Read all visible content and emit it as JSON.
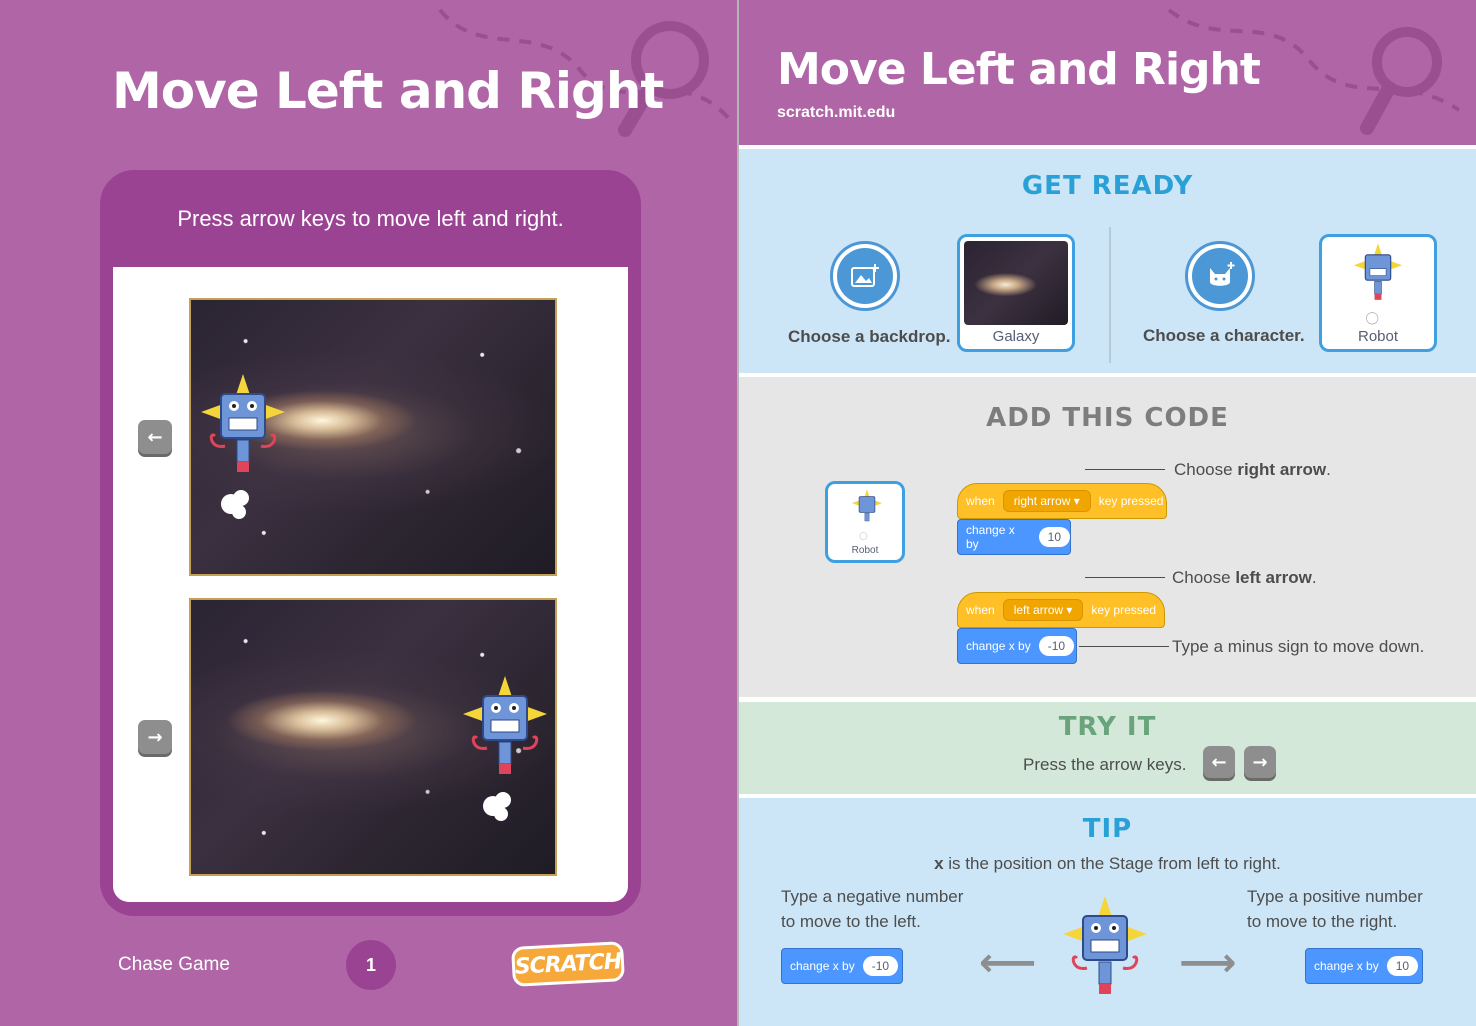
{
  "left": {
    "title": "Move Left and Right",
    "caption": "Press arrow keys to move left and right.",
    "key_left": "←",
    "key_right": "→",
    "footer_text": "Chase Game",
    "page_number": "1",
    "logo_text": "SCRATCH"
  },
  "right": {
    "title": "Move Left and Right",
    "url": "scratch.mit.edu",
    "get_ready": {
      "title": "GET READY",
      "backdrop_label": "Choose a backdrop.",
      "backdrop_thumb": "Galaxy",
      "character_label": "Choose a character.",
      "character_thumb": "Robot"
    },
    "add_code": {
      "title": "ADD THIS CODE",
      "sprite_label": "Robot",
      "script1": {
        "when": "when",
        "key": "right arrow",
        "pressed": "key pressed",
        "change": "change x by",
        "value": "10"
      },
      "script2": {
        "when": "when",
        "key": "left arrow",
        "pressed": "key pressed",
        "change": "change x by",
        "value": "-10"
      },
      "callout1_pre": "Choose ",
      "callout1_bold": "right arrow",
      "callout1_post": ".",
      "callout2_pre": "Choose ",
      "callout2_bold": "left arrow",
      "callout2_post": ".",
      "callout3": "Type a minus sign to move down."
    },
    "try_it": {
      "title": "TRY IT",
      "text": "Press the arrow keys.",
      "key_left": "←",
      "key_right": "→"
    },
    "tip": {
      "title": "TIP",
      "subtitle_bold": "x",
      "subtitle_rest": " is the position on the Stage from left to right.",
      "left_line1": "Type a negative number",
      "left_line2": "to move to the left.",
      "right_line1": "Type a positive number",
      "right_line2": "to move to the right.",
      "left_block": "change x by",
      "left_value": "-10",
      "right_block": "change x by",
      "right_value": "10"
    }
  },
  "colors": {
    "purple": "#b065a7",
    "dark_purple": "#9b4393",
    "ready_bg": "#cde6f7",
    "code_bg": "#e6e6e6",
    "try_bg": "#d4e8d9",
    "event_yellow": "#ffbf26",
    "motion_blue": "#4c97ff"
  },
  "icons": [
    "magnifier-icon",
    "backdrop-icon",
    "sprite-icon",
    "robot-sprite-icon",
    "arrow-left-icon",
    "arrow-right-icon"
  ]
}
